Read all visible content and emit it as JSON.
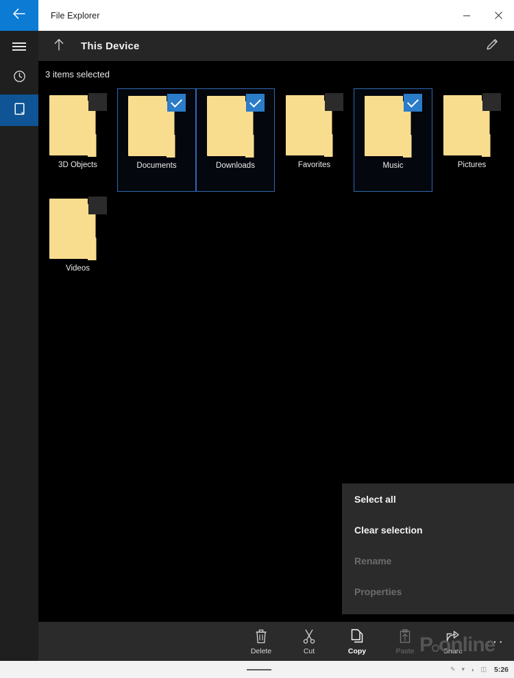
{
  "window": {
    "title": "File Explorer",
    "minimize_label": "Minimize",
    "close_label": "Close"
  },
  "rail": {
    "back_icon": "back-arrow-icon",
    "menu_icon": "hamburger-menu-icon",
    "recent_icon": "clock-recent-icon",
    "device_icon": "this-device-icon",
    "accent_color": "#0b7bd4",
    "selected_color": "#0f5494"
  },
  "command_bar": {
    "up_icon": "up-arrow-icon",
    "location": "This Device",
    "edit_icon": "pencil-edit-icon"
  },
  "content": {
    "status": "3 items selected",
    "background_color": "#000000",
    "selection_border_color": "#2f6ab0",
    "checkbox_on_color": "#2b7cc9",
    "checkbox_off_color": "#2b2b2b",
    "folder_color": "#f9dd8f",
    "items": [
      {
        "label": "3D Objects",
        "selected": false
      },
      {
        "label": "Documents",
        "selected": true
      },
      {
        "label": "Downloads",
        "selected": true
      },
      {
        "label": "Favorites",
        "selected": false
      },
      {
        "label": "Music",
        "selected": true
      },
      {
        "label": "Pictures",
        "selected": false
      },
      {
        "label": "Videos",
        "selected": false
      }
    ]
  },
  "context_menu": {
    "items": [
      {
        "label": "Select all",
        "enabled": true
      },
      {
        "label": "Clear selection",
        "enabled": true
      },
      {
        "label": "Rename",
        "enabled": false
      },
      {
        "label": "Properties",
        "enabled": false
      }
    ]
  },
  "bottom_bar": {
    "commands": [
      {
        "label": "Delete",
        "icon": "trash-icon",
        "state": "normal"
      },
      {
        "label": "Cut",
        "icon": "scissors-icon",
        "state": "normal"
      },
      {
        "label": "Copy",
        "icon": "copy-icon",
        "state": "active"
      },
      {
        "label": "Paste",
        "icon": "paste-icon",
        "state": "disabled"
      },
      {
        "label": "Share",
        "icon": "share-icon",
        "state": "normal"
      }
    ],
    "more_label": "···"
  },
  "watermark": {
    "text_a": "P",
    "text_b": "online"
  },
  "taskbar": {
    "clock": "5:26",
    "tray_icons": [
      "pen-icon",
      "network-icon",
      "volume-icon",
      "battery-icon"
    ]
  }
}
